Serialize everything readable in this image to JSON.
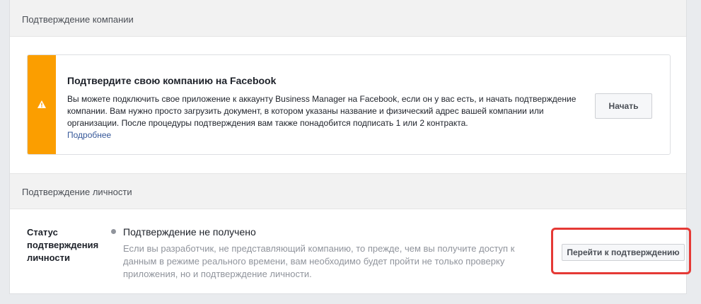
{
  "company_section": {
    "header": "Подтверждение компании",
    "alert": {
      "title": "Подтвердите свою компанию на Facebook",
      "body": "Вы можете подключить свое приложение к аккаунту Business Manager на Facebook, если он у вас есть, и начать подтверждение компании. Вам нужно просто загрузить документ, в котором указаны название и физический адрес вашей компании или организации. После процедуры подтверждения вам также понадобится подписать 1 или 2 контракта.",
      "link": "Подробнее",
      "button": "Начать",
      "icon": "warning-icon",
      "accent_color": "#fb9e00"
    }
  },
  "identity_section": {
    "header": "Подтверждение личности",
    "status_label": "Статус подтверждения личности",
    "status_title": "Подтверждение не получено",
    "status_description": "Если вы разработчик, не представляющий компанию, то прежде, чем вы получите доступ к данным в режиме реального времени, вам необходимо будет пройти не только проверку приложения, но и подтверждение личности.",
    "button": "Перейти к подтверждению",
    "highlight_color": "#e53935"
  }
}
